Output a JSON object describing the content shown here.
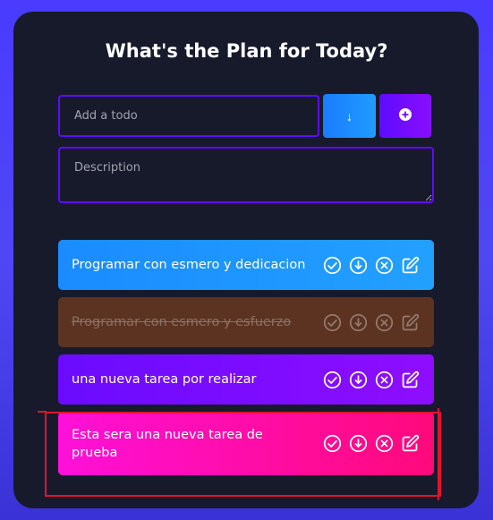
{
  "header": {
    "title": "What's the Plan for Today?"
  },
  "form": {
    "todo_placeholder": "Add a todo",
    "description_placeholder": "Description",
    "sort_label": "↓"
  },
  "todos": [
    {
      "text": "Programar con esmero y dedicacion",
      "completed": false,
      "color": "#1a8cff"
    },
    {
      "text": "Programar con esmero y esfuerzo",
      "completed": true,
      "color": "#5c3321"
    },
    {
      "text": "una nueva tarea por realizar",
      "completed": false,
      "color": "#6a0cff"
    },
    {
      "text": "Esta sera una nueva tarea de prueba",
      "completed": false,
      "color": "#ff10d8"
    }
  ],
  "icons": [
    "check-circle-icon",
    "download-circle-icon",
    "x-circle-icon",
    "edit-icon"
  ],
  "colors": {
    "background": "#4a3bff",
    "card": "#161a2b",
    "input_border": "#5d0cff",
    "annotation": "#e0142e"
  }
}
